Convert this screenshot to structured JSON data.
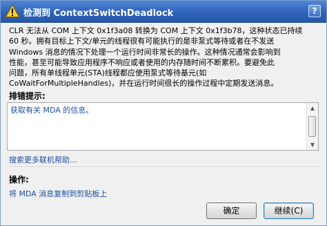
{
  "window": {
    "title": "检测到 ContextSwitchDeadlock",
    "help_label": "?",
    "warning_icon": "warning-triangle-icon"
  },
  "message": {
    "lines": [
      "CLR 无法从 COM 上下文 0x1f3a08 转换为 COM 上下文 0x1f3b78，这种状态已持续",
      "60 秒。拥有目标上下文/单元的线程很有可能执行的是非泵式等待或者在不发送",
      "Windows 消息的情况下处理一个运行时间非常长的操作。这种情况通常会影响到",
      "性能，甚至可能导致应用程序不响应或者使用的内存随时间不断累积。要避免此",
      "问题，所有单线程单元(STA)线程都应使用泵式等待基元(如",
      "CoWaitForMultipleHandles)，并在运行时间很长的操作过程中定期发送消息。"
    ]
  },
  "troubleshooting": {
    "label": "排错提示:",
    "tip_text": "获取有关 MDA 的信息。"
  },
  "links": {
    "more_help": "搜索更多联机帮助...",
    "copy_mda": "将 MDA 消息复制到剪贴板上"
  },
  "actions": {
    "label": "操作:"
  },
  "buttons": {
    "ok": "确定",
    "continue": "继续(C)"
  },
  "colors": {
    "titlebar": "#2f63b8",
    "link": "#1f4ea3",
    "background": "#f0f0f0"
  }
}
